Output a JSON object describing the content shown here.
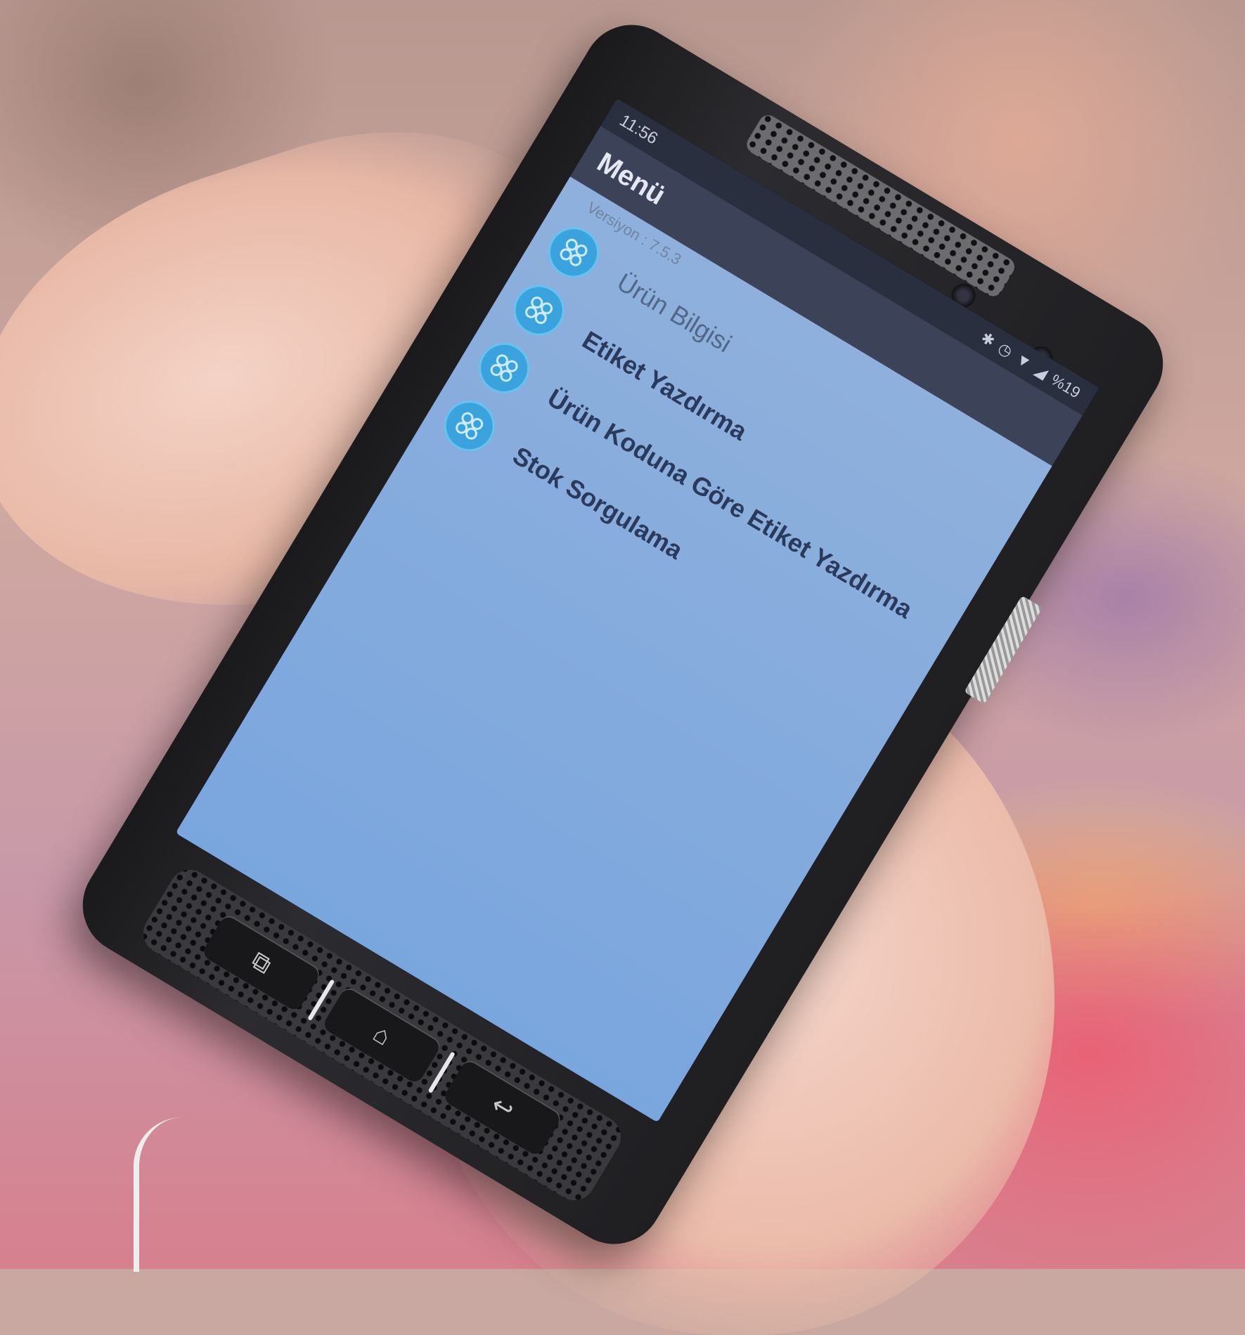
{
  "status_bar": {
    "time": "11:56",
    "battery": "%19",
    "icons": [
      "bluetooth-icon",
      "alarm-icon",
      "wifi-icon",
      "signal-icon",
      "battery-icon"
    ]
  },
  "app_bar": {
    "title": "Menü"
  },
  "version_text": "Versiyon : 7.5.3",
  "menu": {
    "items": [
      {
        "label": "Ürün Bilgisi",
        "icon": "grid-app-icon"
      },
      {
        "label": "Etiket Yazdırma",
        "icon": "grid-app-icon"
      },
      {
        "label": "Ürün Koduna Göre Etiket Yazdırma",
        "icon": "grid-app-icon"
      },
      {
        "label": "Stok Sorgulama",
        "icon": "grid-app-icon"
      }
    ]
  },
  "hardware_keys": {
    "left": "recent-apps-icon",
    "center": "home-icon",
    "right": "back-icon"
  },
  "colors": {
    "status_bar": "#2a2f3f",
    "app_bar": "#3c4258",
    "screen_background": "#7aa6de",
    "menu_icon": "#3aa3de",
    "menu_text": "#2a3a5a"
  }
}
